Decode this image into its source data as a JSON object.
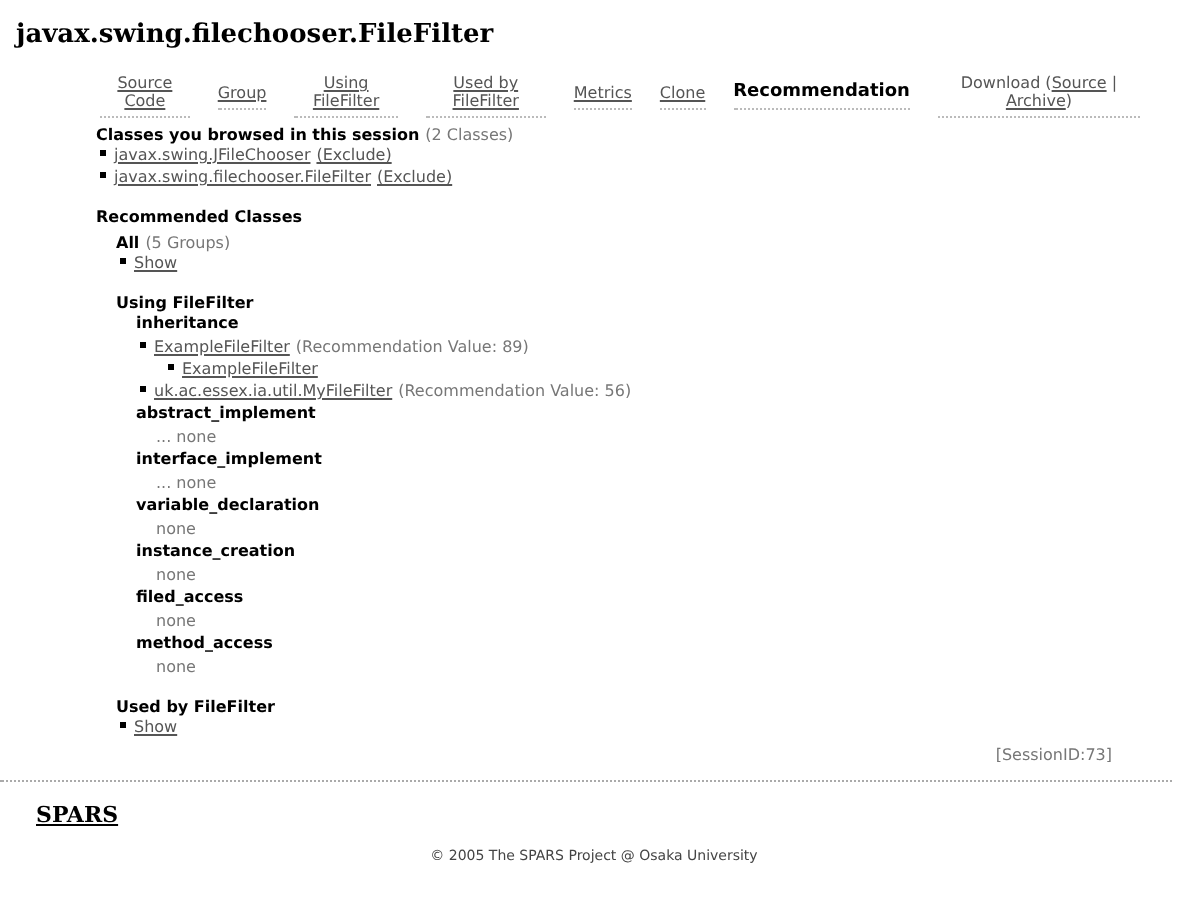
{
  "page_title": "javax.swing.filechooser.FileFilter",
  "nav": [
    {
      "kind": "link",
      "label": "Source Code",
      "selected": false
    },
    {
      "kind": "link",
      "label": "Group",
      "selected": false
    },
    {
      "kind": "link",
      "label": "Using FileFilter",
      "selected": false
    },
    {
      "kind": "link",
      "label": "Used by FileFilter",
      "selected": false
    },
    {
      "kind": "link",
      "label": "Metrics",
      "selected": false
    },
    {
      "kind": "link",
      "label": "Clone",
      "selected": false
    },
    {
      "kind": "link",
      "label": "Recommendation",
      "selected": true
    },
    {
      "kind": "download",
      "parts": [
        {
          "text": "Download (",
          "link": false
        },
        {
          "text": "Source",
          "link": true
        },
        {
          "text": " | ",
          "link": false
        },
        {
          "text": "Archive",
          "link": true
        },
        {
          "text": ")",
          "link": false
        }
      ]
    }
  ],
  "browsed": {
    "heading": "Classes you browsed in this session",
    "count": "(2 Classes)",
    "items": [
      {
        "name": "javax.swing.JFileChooser",
        "action": "(Exclude)"
      },
      {
        "name": "javax.swing.filechooser.FileFilter",
        "action": "(Exclude)"
      }
    ]
  },
  "recommended": {
    "heading": "Recommended Classes",
    "all": {
      "label": "All",
      "count": "(5 Groups)",
      "link": "Show"
    },
    "groups": [
      {
        "heading": "Using FileFilter",
        "categories": [
          {
            "name": "inheritance",
            "items": [
              {
                "name": "ExampleFileFilter",
                "value": "(Recommendation Value: 89)",
                "children": [
                  {
                    "name": "ExampleFileFilter"
                  }
                ]
              },
              {
                "name": "uk.ac.essex.ia.util.MyFileFilter",
                "value": "(Recommendation Value: 56)"
              }
            ]
          },
          {
            "name": "abstract_implement",
            "empty": "... none"
          },
          {
            "name": "interface_implement",
            "empty": "... none"
          },
          {
            "name": "variable_declaration",
            "empty": "none"
          },
          {
            "name": "instance_creation",
            "empty": "none"
          },
          {
            "name": "filed_access",
            "empty": "none"
          },
          {
            "name": "method_access",
            "empty": "none"
          }
        ]
      },
      {
        "heading": "Used by FileFilter",
        "link": "Show"
      }
    ]
  },
  "session": "[SessionID:73]",
  "footer": {
    "logo": "SPARS",
    "copyright": "© 2005 The SPARS Project @ Osaka University"
  }
}
